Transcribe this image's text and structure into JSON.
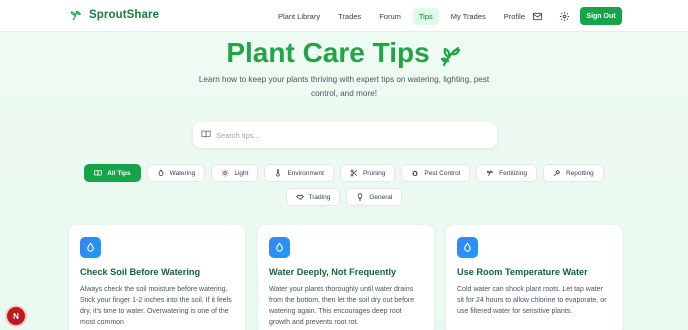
{
  "brand": {
    "name": "SproutShare"
  },
  "nav": {
    "links": [
      {
        "label": "Plant Library",
        "active": false
      },
      {
        "label": "Trades",
        "active": false
      },
      {
        "label": "Forum",
        "active": false
      },
      {
        "label": "Tips",
        "active": true
      },
      {
        "label": "My Trades",
        "active": false
      },
      {
        "label": "Profile",
        "active": false
      }
    ],
    "signout": "Sign Out"
  },
  "hero": {
    "title": "Plant Care Tips",
    "subtitle": "Learn how to keep your plants thriving with expert tips on watering, lighting, pest control, and more!"
  },
  "search": {
    "placeholder": "Search tips..."
  },
  "filters": [
    {
      "label": "All Tips",
      "icon": "book-icon",
      "active": true
    },
    {
      "label": "Watering",
      "icon": "droplet-icon",
      "active": false
    },
    {
      "label": "Light",
      "icon": "sun-icon",
      "active": false
    },
    {
      "label": "Environment",
      "icon": "thermometer-icon",
      "active": false
    },
    {
      "label": "Pruning",
      "icon": "scissors-icon",
      "active": false
    },
    {
      "label": "Pest Control",
      "icon": "bug-icon",
      "active": false
    },
    {
      "label": "Fertilizing",
      "icon": "sprout-icon",
      "active": false
    },
    {
      "label": "Repotting",
      "icon": "shovel-icon",
      "active": false
    },
    {
      "label": "Trading",
      "icon": "handshake-icon",
      "active": false
    },
    {
      "label": "General",
      "icon": "lightbulb-icon",
      "active": false
    }
  ],
  "cards": [
    {
      "title": "Check Soil Before Watering",
      "body": "Always check the soil moisture before watering. Stick your finger 1-2 inches into the soil. If it feels dry, it's time to water. Overwatering is one of the most common"
    },
    {
      "title": "Water Deeply, Not Frequently",
      "body": "Water your plants thoroughly until water drains from the bottom, then let the soil dry out before watering again. This encourages deep root growth and prevents root rot."
    },
    {
      "title": "Use Room Temperature Water",
      "body": "Cold water can shock plant roots. Let tap water sit for 24 hours to allow chlorine to evaporate, or use filtered water for sensitive plants."
    }
  ],
  "fab": {
    "label": "N"
  },
  "colors": {
    "brand": "#16a34a",
    "title": "#22a447",
    "card_title": "#166534",
    "card_icon": "#3b82f6"
  }
}
